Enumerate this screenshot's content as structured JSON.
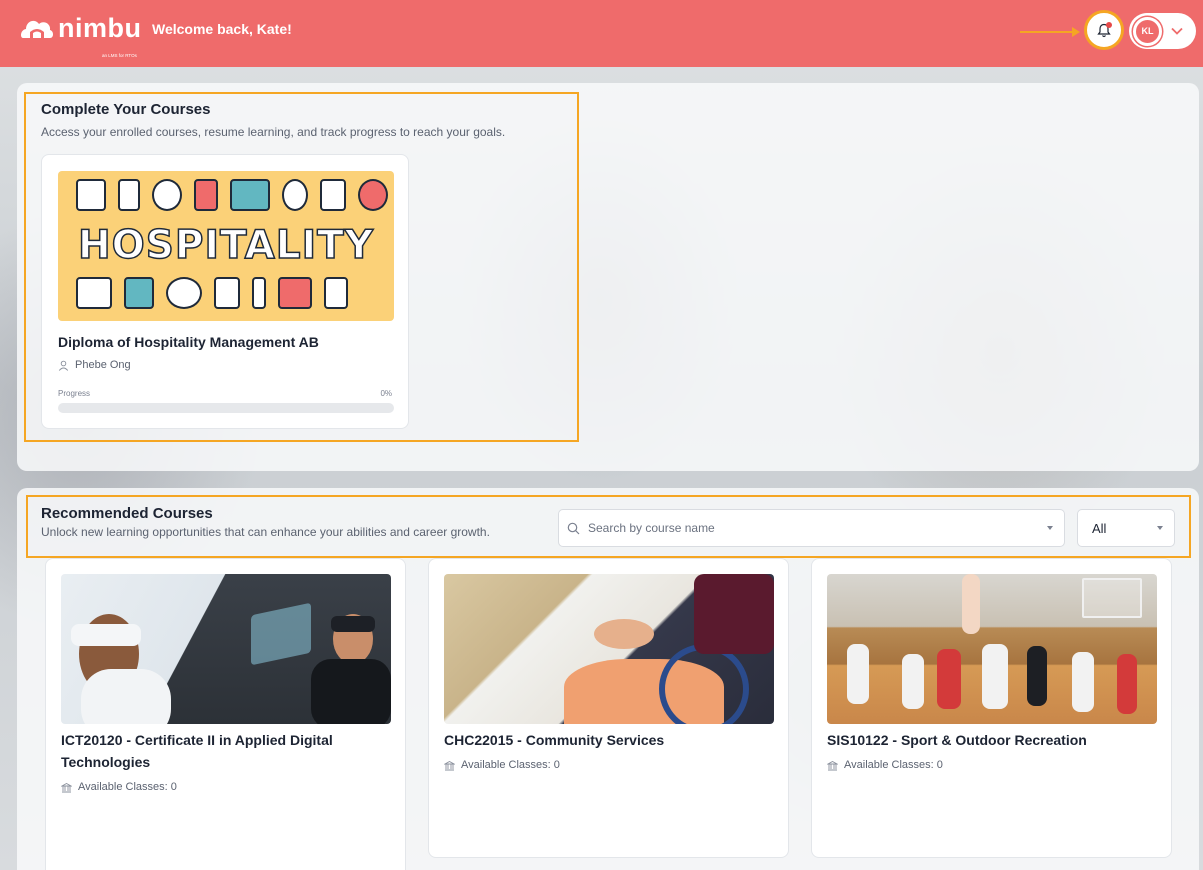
{
  "header": {
    "logo_text": "nimbu",
    "logo_tagline": "an LMS for RTOs",
    "welcome": "Welcome back, Kate!",
    "user_initials": "KL",
    "notification_unread": true
  },
  "complete_courses": {
    "title": "Complete Your Courses",
    "subtitle": "Access your enrolled courses, resume learning, and track progress to reach your goals.",
    "courses": [
      {
        "image_text": "HOSPITALITY",
        "title": "Diploma of Hospitality Management AB",
        "trainer": "Phebe Ong",
        "progress_label": "Progress",
        "progress_text": "0%",
        "progress_value": 0
      }
    ]
  },
  "recommended": {
    "title": "Recommended Courses",
    "subtitle": "Unlock new learning opportunities that can enhance your abilities and career growth.",
    "search_placeholder": "Search by course name",
    "filter_value": "All",
    "courses": [
      {
        "title": "ICT20120 - Certificate II in Applied Digital Technologies",
        "classes": "Available Classes: 0"
      },
      {
        "title": "CHC22015 - Community Services",
        "classes": "Available Classes: 0"
      },
      {
        "title": "SIS10122 - Sport & Outdoor Recreation",
        "classes": "Available Classes: 0"
      }
    ]
  },
  "colors": {
    "brand": "#ef6b6b",
    "highlight": "#f5a623"
  }
}
